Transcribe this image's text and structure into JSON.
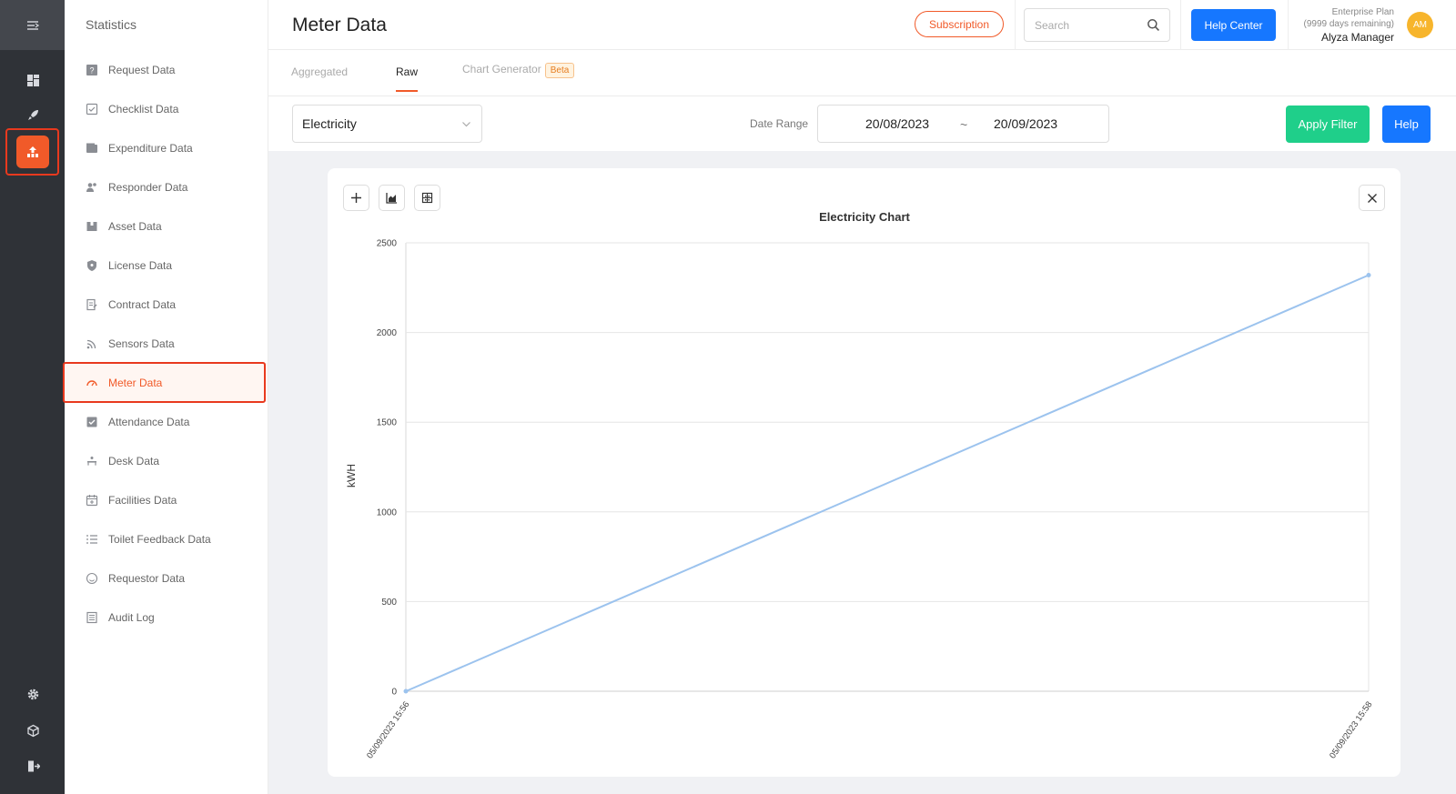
{
  "header": {
    "section_title": "Statistics",
    "page_title": "Meter Data",
    "subscription_label": "Subscription",
    "search_placeholder": "Search",
    "help_center_label": "Help Center",
    "plan_name": "Enterprise Plan",
    "plan_remaining": "(9999 days remaining)",
    "user_name": "Alyza Manager",
    "avatar_initials": "AM"
  },
  "sidebar": {
    "items": [
      {
        "label": "Request Data",
        "icon": "question-icon"
      },
      {
        "label": "Checklist Data",
        "icon": "checklist-icon"
      },
      {
        "label": "Expenditure Data",
        "icon": "wallet-icon"
      },
      {
        "label": "Responder Data",
        "icon": "users-icon"
      },
      {
        "label": "Asset Data",
        "icon": "box-icon"
      },
      {
        "label": "License Data",
        "icon": "shield-icon"
      },
      {
        "label": "Contract Data",
        "icon": "contract-icon"
      },
      {
        "label": "Sensors Data",
        "icon": "signal-icon"
      },
      {
        "label": "Meter Data",
        "icon": "gauge-icon",
        "active": true
      },
      {
        "label": "Attendance Data",
        "icon": "check-square-icon"
      },
      {
        "label": "Desk Data",
        "icon": "desk-icon"
      },
      {
        "label": "Facilities Data",
        "icon": "calendar-icon"
      },
      {
        "label": "Toilet Feedback Data",
        "icon": "list-icon"
      },
      {
        "label": "Requestor Data",
        "icon": "smile-icon"
      },
      {
        "label": "Audit Log",
        "icon": "log-icon"
      }
    ]
  },
  "tabs": [
    {
      "label": "Aggregated",
      "active": false
    },
    {
      "label": "Raw",
      "active": true
    },
    {
      "label": "Chart Generator",
      "badge": "Beta",
      "active": false
    }
  ],
  "filters": {
    "meter_type": "Electricity",
    "date_range_label": "Date Range",
    "date_from": "20/08/2023",
    "date_sep": "~",
    "date_to": "20/09/2023",
    "apply_label": "Apply Filter",
    "help_label": "Help"
  },
  "colors": {
    "accent": "#f15a29",
    "primary": "#1677ff",
    "success": "#1fcf8a",
    "line": "#9cc3ee"
  },
  "chart_data": {
    "type": "line",
    "title": "Electricity Chart",
    "xlabel": "",
    "ylabel": "kWH",
    "x": [
      "05/09/2023 15:56",
      "05/09/2023 15:58"
    ],
    "series": [
      {
        "values": [
          0,
          2320
        ]
      }
    ],
    "ylim": [
      0,
      2500
    ],
    "yticks": [
      0,
      500,
      1000,
      1500,
      2000,
      2500
    ],
    "grid": true
  }
}
